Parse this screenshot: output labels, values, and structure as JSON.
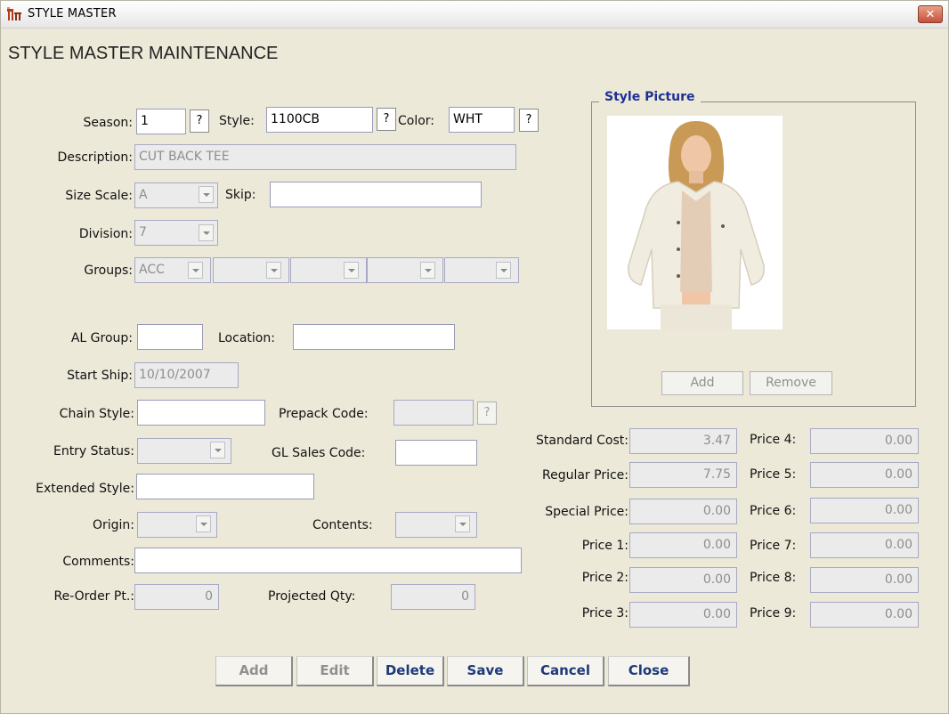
{
  "window": {
    "title": "STYLE MASTER",
    "icon": "chair-table-icon"
  },
  "form": {
    "heading": "STYLE MASTER MAINTENANCE",
    "season": {
      "label": "Season:",
      "value": "1"
    },
    "style": {
      "label": "Style:",
      "value": "1100CB"
    },
    "color": {
      "label": "Color:",
      "value": "WHT"
    },
    "lookup_label": "?",
    "description": {
      "label": "Description:",
      "value": "CUT BACK TEE"
    },
    "size_scale": {
      "label": "Size Scale:",
      "value": "A"
    },
    "skip": {
      "label": "Skip:",
      "value": ""
    },
    "division": {
      "label": "Division:",
      "value": "7"
    },
    "groups": {
      "label": "Groups:",
      "values": [
        "ACC",
        "",
        "",
        "",
        ""
      ]
    },
    "al_group": {
      "label": "AL Group:",
      "value": ""
    },
    "location": {
      "label": "Location:",
      "value": ""
    },
    "start_ship": {
      "label": "Start Ship:",
      "value": "10/10/2007"
    },
    "chain_style": {
      "label": "Chain Style:",
      "value": ""
    },
    "prepack_code": {
      "label": "Prepack Code:",
      "value": ""
    },
    "entry_status": {
      "label": "Entry Status:",
      "value": ""
    },
    "gl_sales_code": {
      "label": "GL Sales Code:",
      "value": ""
    },
    "extended_style": {
      "label": "Extended Style:",
      "value": ""
    },
    "origin": {
      "label": "Origin:",
      "value": ""
    },
    "contents": {
      "label": "Contents:",
      "value": ""
    },
    "comments": {
      "label": "Comments:",
      "value": ""
    },
    "reorder_pt": {
      "label": "Re-Order Pt.:",
      "value": "0"
    },
    "projected_qty": {
      "label": "Projected Qty:",
      "value": "0"
    }
  },
  "pricing": {
    "standard_cost": {
      "label": "Standard  Cost:",
      "value": "3.47"
    },
    "regular_price": {
      "label": "Regular Price:",
      "value": "7.75"
    },
    "special_price": {
      "label": "Special Price:",
      "value": "0.00"
    },
    "price1": {
      "label": "Price 1:",
      "value": "0.00"
    },
    "price2": {
      "label": "Price 2:",
      "value": "0.00"
    },
    "price3": {
      "label": "Price 3:",
      "value": "0.00"
    },
    "price4": {
      "label": "Price 4:",
      "value": "0.00"
    },
    "price5": {
      "label": "Price 5:",
      "value": "0.00"
    },
    "price6": {
      "label": "Price 6:",
      "value": "0.00"
    },
    "price7": {
      "label": "Price 7:",
      "value": "0.00"
    },
    "price8": {
      "label": "Price 8:",
      "value": "0.00"
    },
    "price9": {
      "label": "Price 9:",
      "value": "0.00"
    }
  },
  "picture": {
    "legend": "Style Picture",
    "add": "Add",
    "remove": "Remove"
  },
  "actions": {
    "add": "Add",
    "edit": "Edit",
    "delete": "Delete",
    "save": "Save",
    "cancel": "Cancel",
    "close": "Close"
  },
  "colors": {
    "accent": "#1f2f96",
    "background": "#ece9d8",
    "close": "#c6513a"
  }
}
